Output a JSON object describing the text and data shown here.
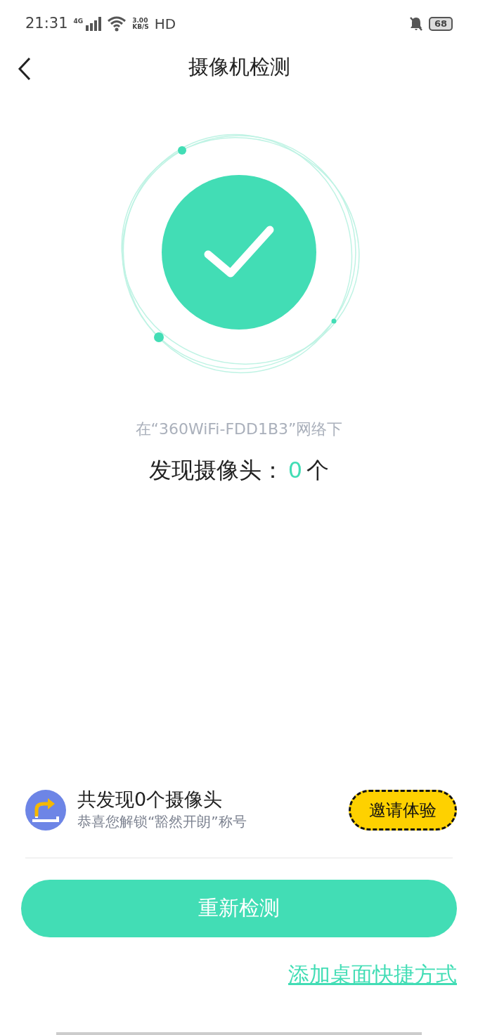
{
  "status_bar": {
    "time": "21:31",
    "network": "4G",
    "speed_value": "3.00",
    "speed_unit": "KB/S",
    "hd": "HD",
    "battery": "68"
  },
  "header": {
    "title": "摄像机检测"
  },
  "result": {
    "network_note": "在“360WiFi-FDD1B3”网络下",
    "count_label": "发现摄像头：",
    "count": "0",
    "count_unit": "个"
  },
  "achievement": {
    "title": "共发现0个摄像头",
    "subtitle": "恭喜您解锁“豁然开朗”称号",
    "invite_button": "邀请体验"
  },
  "rescan_button": "重新检测",
  "shortcut_link": "添加桌面快捷方式"
}
